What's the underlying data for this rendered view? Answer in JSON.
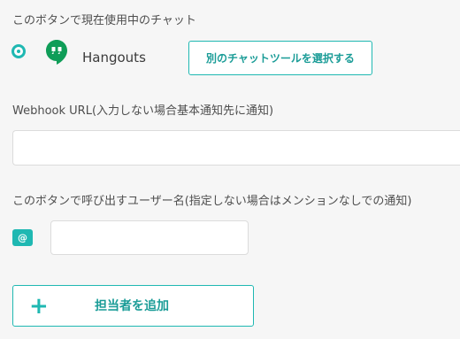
{
  "chat_section": {
    "label": "このボタンで現在使用中のチャット",
    "app_name": "Hangouts",
    "select_button": "別のチャットツールを選択する"
  },
  "webhook": {
    "label": "Webhook URL(入力しない場合基本通知先に通知)",
    "value": "",
    "placeholder": ""
  },
  "mention": {
    "label": "このボタンで呼び出すユーザー名(指定しない場合はメンションなしでの通知)",
    "badge": "@",
    "value": "",
    "placeholder": ""
  },
  "add_button": {
    "icon": "+",
    "label": "担当者を追加"
  },
  "colors": {
    "accent": "#1fb8b2",
    "hangouts": "#0f9d58"
  }
}
